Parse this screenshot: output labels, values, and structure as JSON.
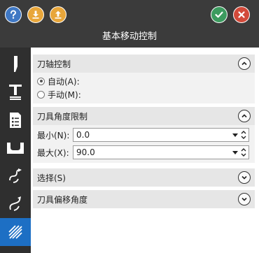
{
  "window": {
    "title": "基本移动控制"
  },
  "toolbar": {
    "help": "help-icon",
    "import": "import-icon",
    "export": "export-icon",
    "ok": "check-icon",
    "close": "close-icon"
  },
  "colors": {
    "titlebar": "#3b3b3b",
    "sidebar": "#2f2f2f",
    "active": "#1d6fc4",
    "ok": "#3c9b5f",
    "close": "#d24a3a",
    "io": "#e8a63a",
    "help": "#3f78c4"
  },
  "sidebar": {
    "items": [
      {
        "icon": "tool-icon"
      },
      {
        "icon": "tool-height-icon"
      },
      {
        "icon": "list-icon"
      },
      {
        "icon": "pocket-icon"
      },
      {
        "icon": "link-motion-icon"
      },
      {
        "icon": "link-motion-alt-icon"
      },
      {
        "icon": "hatch-pattern-icon",
        "active": true
      }
    ]
  },
  "sections": {
    "tool_axis": {
      "title": "刀轴控制",
      "options": [
        {
          "label": "自动(A):",
          "checked": true
        },
        {
          "label": "手动(M):",
          "checked": false
        }
      ]
    },
    "tool_angle_limit": {
      "title": "刀具角度限制",
      "min_label": "最小(N):",
      "min_value": "0.0",
      "max_label": "最大(X):",
      "max_value": "90.0"
    },
    "select": {
      "title": "选择(S)"
    },
    "tool_offset_angle": {
      "title": "刀具偏移角度"
    }
  }
}
